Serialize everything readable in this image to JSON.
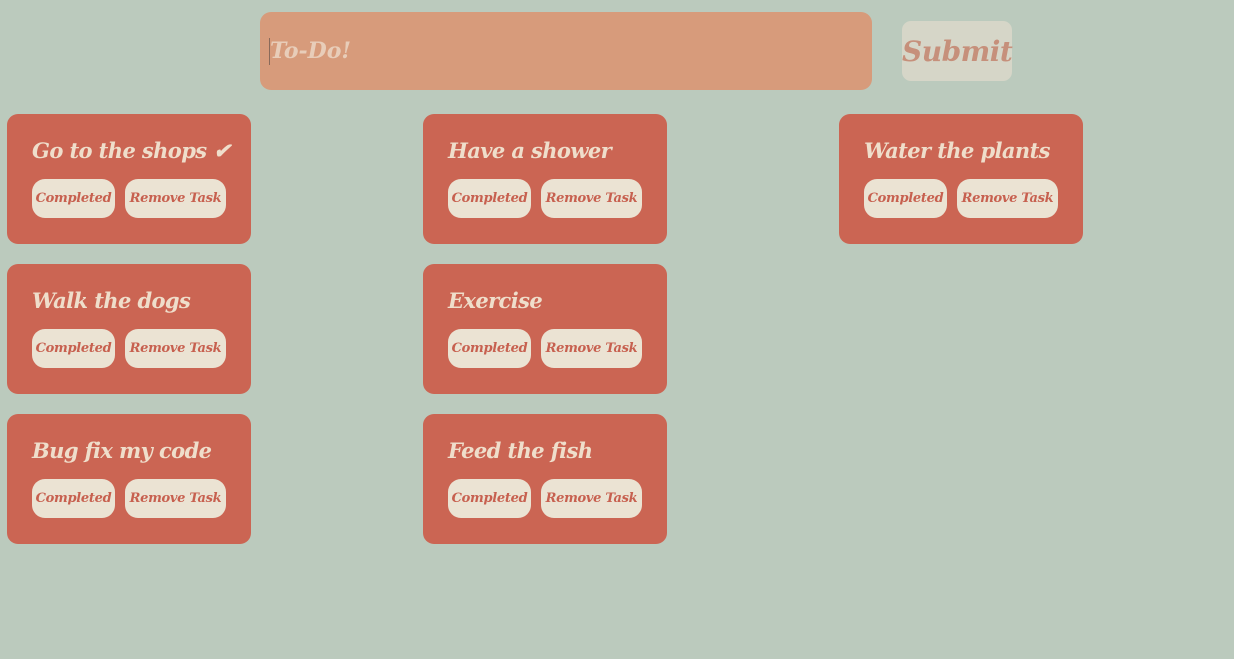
{
  "input": {
    "placeholder": "To-Do!",
    "value": ""
  },
  "submit_label": "Submit",
  "buttons": {
    "completed_label": "Completed",
    "remove_label": "Remove Task"
  },
  "tasks": [
    {
      "title": "Go to the shops ✔"
    },
    {
      "title": "Have a shower"
    },
    {
      "title": "Water the plants"
    },
    {
      "title": "Walk the dogs"
    },
    {
      "title": "Exercise"
    },
    {
      "title": "Bug fix my code"
    },
    {
      "title": "Feed the fish"
    }
  ],
  "colors": {
    "background": "#bbcabd",
    "card": "#cb6553",
    "card_text": "#efdecb",
    "button_bg": "#ebe3d3",
    "button_text": "#c7604f",
    "input_bg": "#d79b7b",
    "submit_bg": "#d6d6c8",
    "submit_text": "#c6907b"
  }
}
